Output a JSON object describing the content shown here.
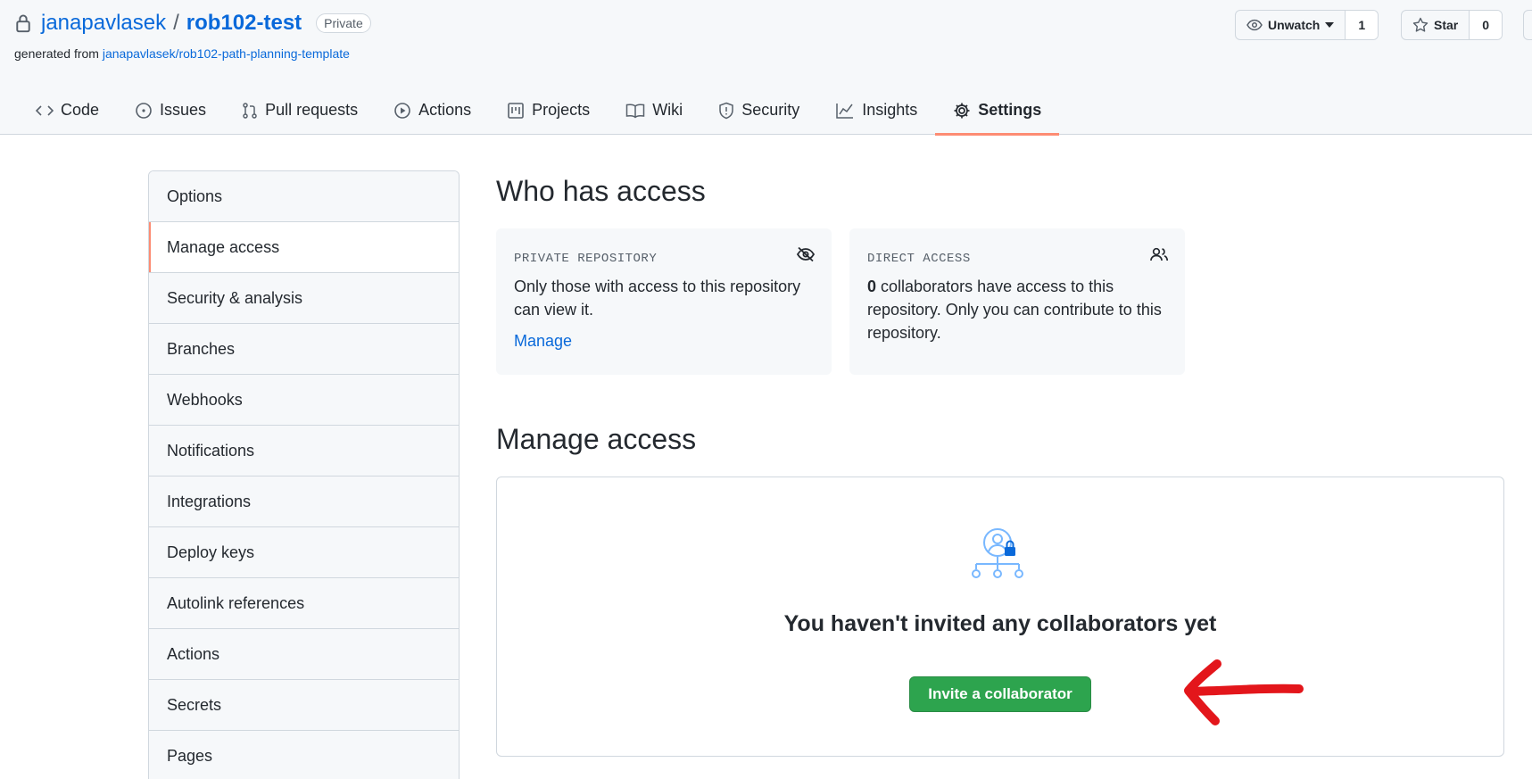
{
  "repo": {
    "owner": "janapavlasek",
    "separator": "/",
    "name": "rob102-test",
    "visibility_badge": "Private",
    "generated_prefix": "generated from",
    "template_link": "janapavlasek/rob102-path-planning-template"
  },
  "actions_bar": {
    "watch_label": "Unwatch",
    "watch_count": "1",
    "star_label": "Star",
    "star_count": "0"
  },
  "tabs": [
    {
      "label": "Code",
      "icon": "code-icon"
    },
    {
      "label": "Issues",
      "icon": "issue-opened-icon"
    },
    {
      "label": "Pull requests",
      "icon": "git-pull-request-icon"
    },
    {
      "label": "Actions",
      "icon": "play-icon"
    },
    {
      "label": "Projects",
      "icon": "project-icon"
    },
    {
      "label": "Wiki",
      "icon": "book-icon"
    },
    {
      "label": "Security",
      "icon": "shield-icon"
    },
    {
      "label": "Insights",
      "icon": "graph-icon"
    },
    {
      "label": "Settings",
      "icon": "gear-icon",
      "active": true
    }
  ],
  "sidebar": {
    "items": [
      {
        "label": "Options"
      },
      {
        "label": "Manage access",
        "selected": true
      },
      {
        "label": "Security & analysis"
      },
      {
        "label": "Branches"
      },
      {
        "label": "Webhooks"
      },
      {
        "label": "Notifications"
      },
      {
        "label": "Integrations"
      },
      {
        "label": "Deploy keys"
      },
      {
        "label": "Autolink references"
      },
      {
        "label": "Actions"
      },
      {
        "label": "Secrets"
      },
      {
        "label": "Pages"
      }
    ]
  },
  "who_has_access": {
    "title": "Who has access",
    "private_card": {
      "label": "PRIVATE REPOSITORY",
      "text": "Only those with access to this repository can view it.",
      "link": "Manage"
    },
    "direct_card": {
      "label": "DIRECT ACCESS",
      "count": "0",
      "text": " collaborators have access to this repository. Only you can contribute to this repository."
    }
  },
  "manage_access": {
    "title": "Manage access",
    "empty_heading": "You haven't invited any collaborators yet",
    "invite_button": "Invite a collaborator"
  },
  "colors": {
    "link": "#0969da",
    "active_tab_underline": "#fd8c73",
    "primary_button": "#2da44e",
    "annotation_arrow": "#e3161b"
  }
}
